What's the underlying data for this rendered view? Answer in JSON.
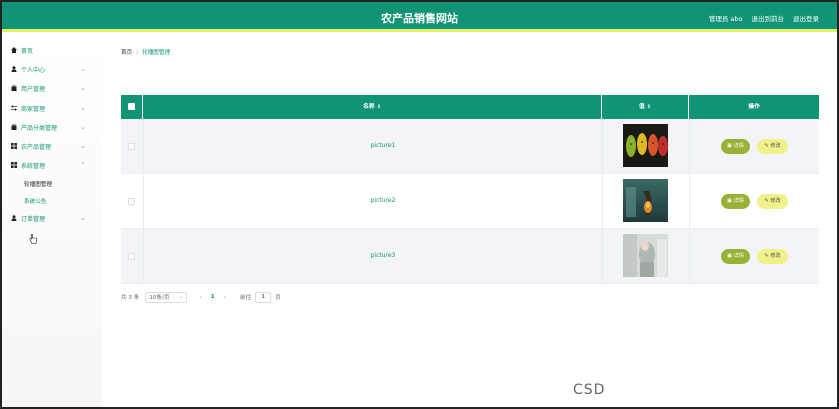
{
  "header": {
    "title": "农产品销售网站",
    "admin_label": "管理员 abo",
    "back_label": "退出到前台",
    "logout_label": "退出登录"
  },
  "sidebar": {
    "items": [
      {
        "label": "首页",
        "icon": "home-icon"
      },
      {
        "label": "个人中心",
        "icon": "user-icon"
      },
      {
        "label": "用户管理",
        "icon": "bag-icon"
      },
      {
        "label": "商家管理",
        "icon": "sliders-icon"
      },
      {
        "label": "产品分类管理",
        "icon": "bag-icon"
      },
      {
        "label": "农产品管理",
        "icon": "grid-icon"
      },
      {
        "label": "系统管理",
        "icon": "grid-icon"
      }
    ],
    "sub_items": [
      "轮播图管理",
      "系统公告"
    ],
    "last_item": {
      "label": "订单管理",
      "icon": "user-icon"
    }
  },
  "breadcrumb": {
    "home": "首页",
    "separator": "/",
    "current": "轮播图管理"
  },
  "table": {
    "columns": {
      "name": "名称",
      "value": "值",
      "actions": "操作"
    },
    "rows": [
      {
        "name": "picture1"
      },
      {
        "name": "picture2"
      },
      {
        "name": "picture3"
      }
    ],
    "detail_label": "详情",
    "edit_label": "修改"
  },
  "pagination": {
    "total": "共 3 条",
    "page_size": "10条/页",
    "current_page": "1",
    "goto_label": "前往",
    "goto_value": "1",
    "unit": "页"
  },
  "watermark": "CSD",
  "colors": {
    "primary": "#119475",
    "accent": "#e2f06a",
    "detail": "#98b236",
    "edit": "#f1f18a"
  }
}
